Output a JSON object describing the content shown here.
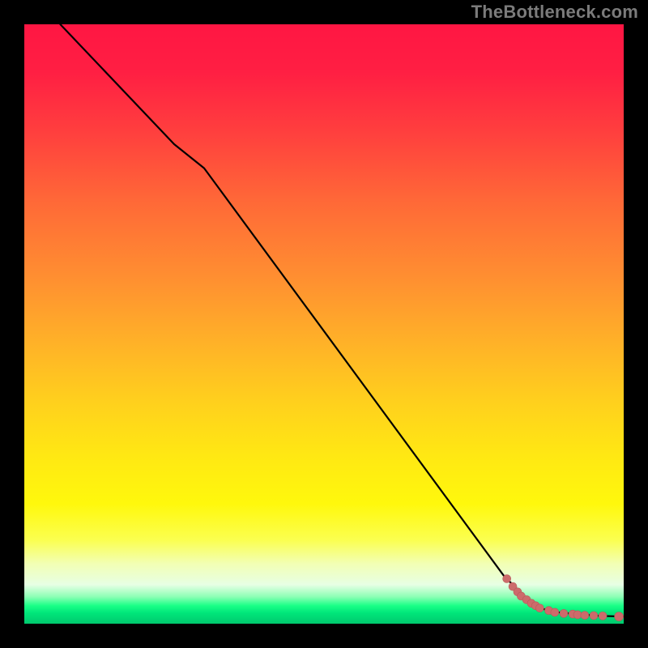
{
  "watermark": "TheBottleneck.com",
  "colors": {
    "black": "#000000",
    "line": "#000000",
    "dot_fill": "#cc6b6b",
    "dot_stroke": "#b95a5a",
    "gradient_top": "#ff1643",
    "gradient_mid": "#ffe813",
    "gradient_bottom": "#00c96e"
  },
  "chart_data": {
    "type": "line",
    "title": "",
    "xlabel": "",
    "ylabel": "",
    "xlim": [
      0,
      100
    ],
    "ylim": [
      0,
      100
    ],
    "grid": false,
    "legend": false,
    "series": [
      {
        "name": "curve",
        "kind": "line",
        "x": [
          6,
          25,
          30,
          80,
          85,
          88,
          92,
          96,
          100
        ],
        "y": [
          100,
          80,
          76,
          8,
          3,
          2,
          1.6,
          1.3,
          1.2
        ]
      },
      {
        "name": "points",
        "kind": "scatter",
        "x": [
          80.5,
          81.5,
          82.3,
          82.9,
          83.8,
          84.6,
          85.3,
          86.0,
          87.5,
          88.5,
          90.0,
          91.5,
          92.3,
          93.5,
          95.0,
          96.5,
          99.2
        ],
        "y": [
          7.5,
          6.2,
          5.3,
          4.6,
          4.0,
          3.4,
          3.0,
          2.6,
          2.2,
          1.9,
          1.7,
          1.6,
          1.5,
          1.4,
          1.35,
          1.3,
          1.2
        ]
      }
    ]
  }
}
